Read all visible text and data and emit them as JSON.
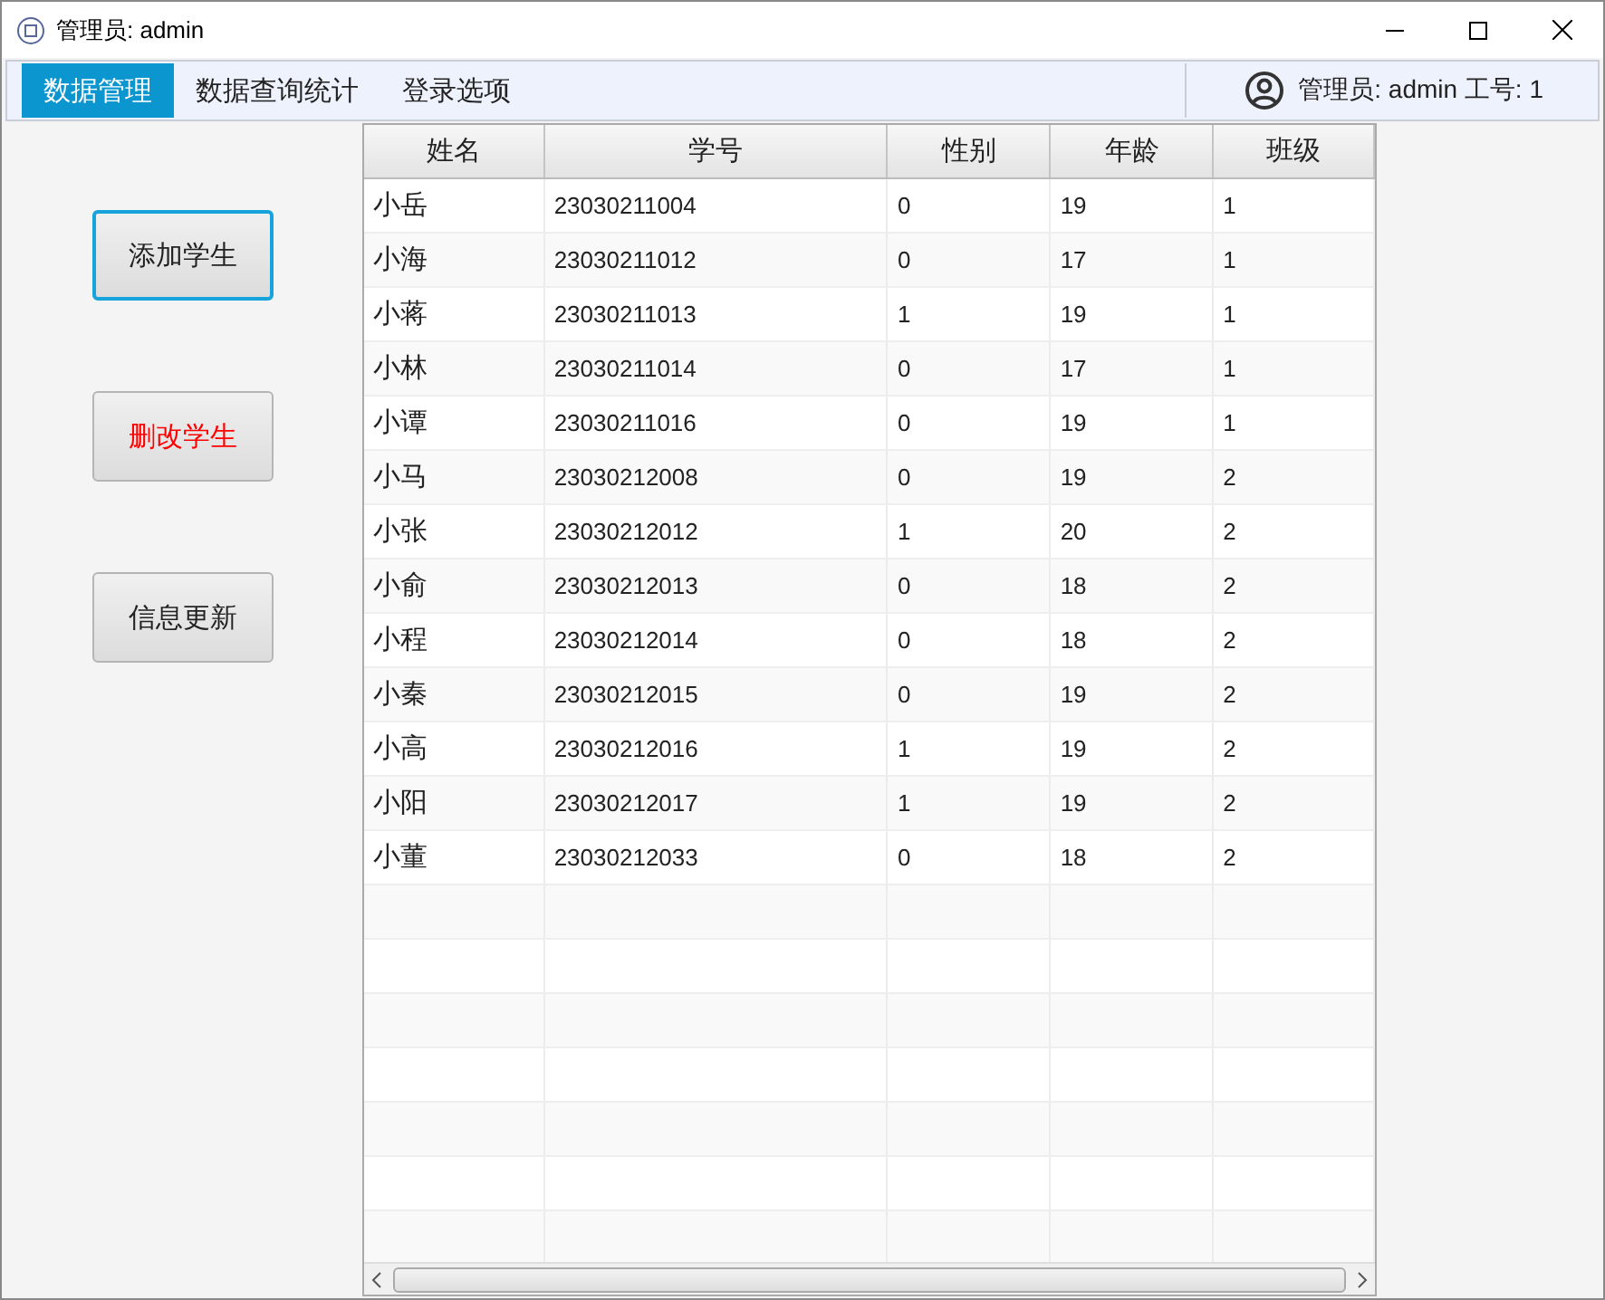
{
  "window": {
    "title": "管理员:  admin"
  },
  "menu": [
    {
      "label": "数据管理",
      "selected": true
    },
    {
      "label": "数据查询统计",
      "selected": false
    },
    {
      "label": "登录选项",
      "selected": false
    }
  ],
  "user": {
    "label": "管理员: admin 工号: 1"
  },
  "actions": [
    {
      "label": "添加学生",
      "focused": true,
      "color": "#222222"
    },
    {
      "label": "删改学生",
      "focused": false,
      "color": "#ff0000"
    },
    {
      "label": "信息更新",
      "focused": false,
      "color": "#222222"
    }
  ],
  "table": {
    "columns": [
      "姓名",
      "学号",
      "性别",
      "年龄",
      "班级"
    ],
    "rows": [
      [
        "小岳",
        "23030211004",
        "0",
        "19",
        "1"
      ],
      [
        "小海",
        "23030211012",
        "0",
        "17",
        "1"
      ],
      [
        "小蒋",
        "23030211013",
        "1",
        "19",
        "1"
      ],
      [
        "小林",
        "23030211014",
        "0",
        "17",
        "1"
      ],
      [
        "小谭",
        "23030211016",
        "0",
        "19",
        "1"
      ],
      [
        "小马",
        "23030212008",
        "0",
        "19",
        "2"
      ],
      [
        "小张",
        "23030212012",
        "1",
        "20",
        "2"
      ],
      [
        "小俞",
        "23030212013",
        "0",
        "18",
        "2"
      ],
      [
        "小程",
        "23030212014",
        "0",
        "18",
        "2"
      ],
      [
        "小秦",
        "23030212015",
        "0",
        "19",
        "2"
      ],
      [
        "小高",
        "23030212016",
        "1",
        "19",
        "2"
      ],
      [
        "小阳",
        "23030212017",
        "1",
        "19",
        "2"
      ],
      [
        "小董",
        "23030212033",
        "0",
        "18",
        "2"
      ]
    ]
  }
}
